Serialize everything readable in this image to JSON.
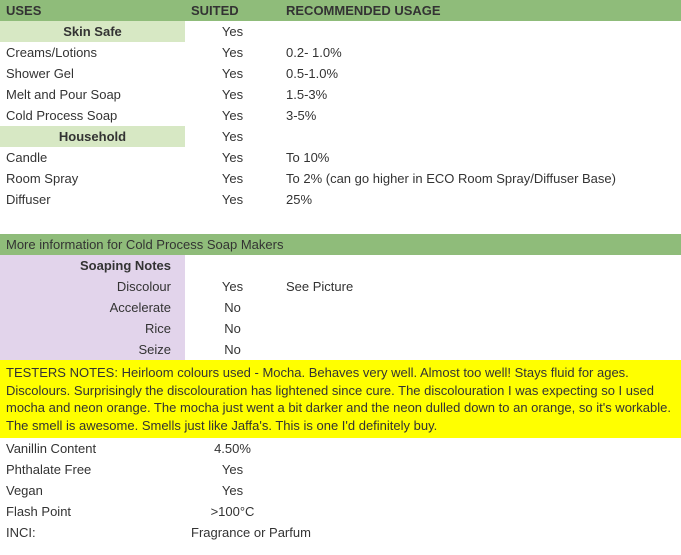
{
  "headers": {
    "uses": "USES",
    "suited": "SUITED",
    "recommended": "RECOMMENDED USAGE"
  },
  "sections": {
    "skinSafe": {
      "label": "Skin Safe",
      "suited": "Yes"
    },
    "household": {
      "label": "Household",
      "suited": "Yes"
    }
  },
  "uses": {
    "creams": {
      "name": "Creams/Lotions",
      "suited": "Yes",
      "rec": "0.2- 1.0%"
    },
    "shower": {
      "name": "Shower Gel",
      "suited": "Yes",
      "rec": "0.5-1.0%"
    },
    "meltpour": {
      "name": "Melt and Pour Soap",
      "suited": "Yes",
      "rec": "1.5-3%"
    },
    "coldproc": {
      "name": "Cold Process Soap",
      "suited": "Yes",
      "rec": "3-5%"
    },
    "candle": {
      "name": "Candle",
      "suited": "Yes",
      "rec": "To 10%"
    },
    "roomspray": {
      "name": "Room Spray",
      "suited": "Yes",
      "rec": "To 2% (can go higher in ECO Room Spray/Diffuser Base)"
    },
    "diffuser": {
      "name": "Diffuser",
      "suited": "Yes",
      "rec": "25%"
    }
  },
  "coldProcessHeader": "More information for Cold Process Soap Makers",
  "soapingNotesLabel": "Soaping Notes",
  "soaping": {
    "discolour": {
      "label": "Discolour",
      "val": "Yes",
      "note": "See Picture"
    },
    "accelerate": {
      "label": "Accelerate",
      "val": "No"
    },
    "rice": {
      "label": "Rice",
      "val": "No"
    },
    "seize": {
      "label": "Seize",
      "val": "No"
    }
  },
  "testerNotes": "TESTERS NOTES: Heirloom colours used - Mocha.   Behaves very well. Almost too well! Stays fluid for ages.   Discolours. Surprisingly the discolouration has lightened since cure.  The discolouration I was expecting so I used mocha and neon orange. The mocha just went a bit darker and the neon dulled down to an orange, so it's workable.  The smell is awesome. Smells just like Jaffa's. This is one I'd definitely buy.",
  "properties": {
    "vanillin": {
      "label": "Vanillin Content",
      "val": "4.50%"
    },
    "phthalate": {
      "label": "Phthalate Free",
      "val": "Yes"
    },
    "vegan": {
      "label": "Vegan",
      "val": "Yes"
    },
    "flash": {
      "label": "Flash Point",
      "val": ">100°C"
    },
    "inci": {
      "label": "INCI:",
      "val": "Fragrance or Parfum"
    }
  }
}
